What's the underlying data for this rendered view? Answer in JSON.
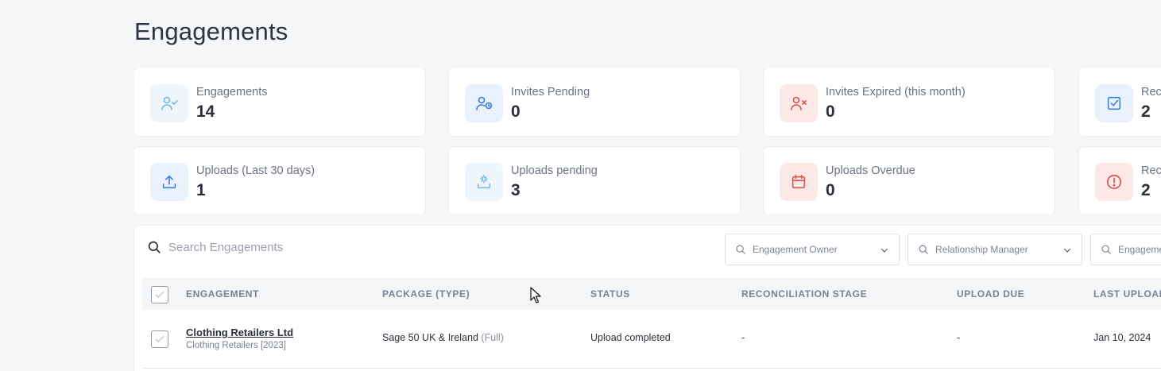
{
  "page": {
    "title": "Engagements"
  },
  "cards": [
    {
      "label": "Engagements",
      "value": "14",
      "icon": "user-check-icon",
      "tone": "lightblue"
    },
    {
      "label": "Invites Pending",
      "value": "0",
      "icon": "user-clock-icon",
      "tone": "blue"
    },
    {
      "label": "Invites Expired (this month)",
      "value": "0",
      "icon": "user-x-icon",
      "tone": "red"
    },
    {
      "label": "Reco",
      "value": "2",
      "icon": "checkbox-icon",
      "tone": "blue"
    },
    {
      "label": "Uploads (Last 30 days)",
      "value": "1",
      "icon": "upload-icon",
      "tone": "blue"
    },
    {
      "label": "Uploads pending",
      "value": "3",
      "icon": "loading-upload-icon",
      "tone": "lightblue"
    },
    {
      "label": "Uploads Overdue",
      "value": "0",
      "icon": "calendar-icon",
      "tone": "red"
    },
    {
      "label": "Reco",
      "value": "2",
      "icon": "alert-circle-icon",
      "tone": "red"
    }
  ],
  "search": {
    "placeholder": "Search Engagements"
  },
  "filters": [
    {
      "placeholder": "Engagement Owner"
    },
    {
      "placeholder": "Relationship Manager"
    },
    {
      "placeholder": "Engagemen"
    }
  ],
  "table": {
    "columns": [
      "ENGAGEMENT",
      "PACKAGE (TYPE)",
      "STATUS",
      "RECONCILIATION STAGE",
      "UPLOAD DUE",
      "LAST UPLOAD"
    ],
    "rows": [
      {
        "name": "Clothing Retailers Ltd",
        "sub": "Clothing Retailers [2023]",
        "package": "Sage 50 UK & Ireland",
        "package_type": "(Full)",
        "status": "Upload completed",
        "reconciliation_stage": "-",
        "upload_due": "-",
        "last_upload": "Jan 10, 2024"
      }
    ]
  },
  "colors": {
    "blue": "#3b7fd0",
    "lightblue": "#76b6e3",
    "red": "#d9534f"
  }
}
